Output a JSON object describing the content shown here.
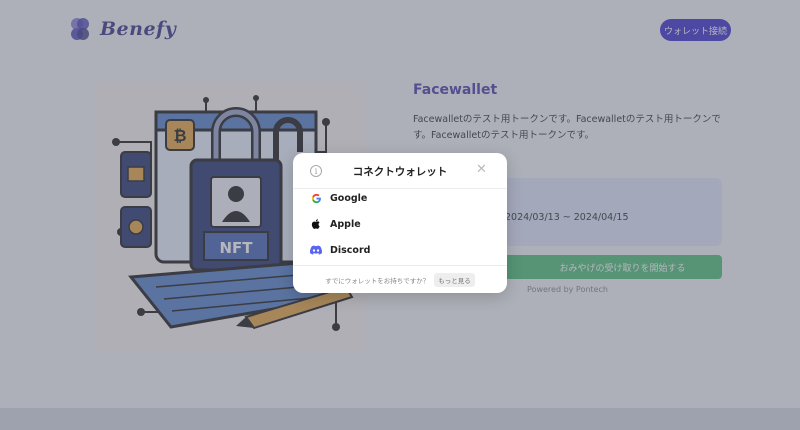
{
  "header": {
    "brand": "Benefy",
    "connect_label": "ウォレット接続"
  },
  "product": {
    "title": "Facewallet",
    "description": "Facewalletのテスト用トークンです。Facewalletのテスト用トークンです。Facewalletのテスト用トークンです。",
    "period": "2024/03/13 ~ 2024/04/15",
    "receive_label": "おみやげの受け取りを開始する",
    "powered_by": "Powered by Pontech",
    "image_text": "NFT"
  },
  "modal": {
    "title": "コネクトウォレット",
    "options": [
      {
        "label": "Google",
        "icon": "google-icon"
      },
      {
        "label": "Apple",
        "icon": "apple-icon"
      },
      {
        "label": "Discord",
        "icon": "discord-icon"
      }
    ],
    "footer_text": "すでにウォレットをお持ちですか？",
    "more_label": "もっと見る"
  },
  "colors": {
    "brand": "#4338ca",
    "accent_green": "#52c27a",
    "title_purple": "#4b45a8"
  }
}
